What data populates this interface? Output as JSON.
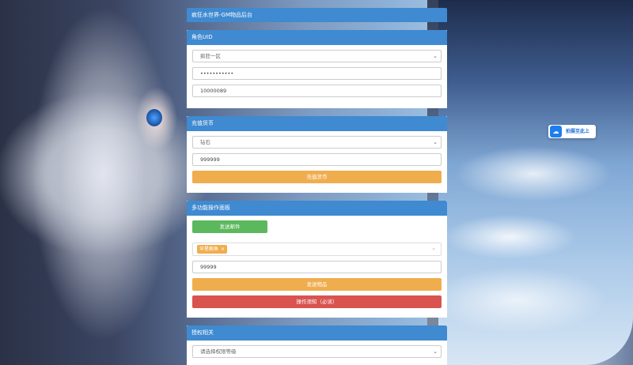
{
  "page_title": "疯狂水世界-GM物品后台",
  "role_card": {
    "header": "角色UID",
    "server_select": "疯狂一区",
    "password_value": "•••••••••••",
    "uid_value": "10000089"
  },
  "recharge_card": {
    "header": "充值货币",
    "currency_select": "钻石",
    "amount_value": "999999",
    "submit_label": "充值货币"
  },
  "multi_card": {
    "header": "多功能操作面板",
    "send_mail_label": "发送邮件",
    "selected_tag": "罕星鲸鱼",
    "tag_close": "×",
    "quantity_value": "99999",
    "send_item_label": "发送物品",
    "notice_label": "操作须知（必读）"
  },
  "auth_card": {
    "header": "授权相关",
    "level_placeholder": "请选择权限等级"
  },
  "float_button": {
    "label": "拍摄至此上",
    "icon": "cloud-icon"
  },
  "colors": {
    "header_blue": "#3f8ad0",
    "orange": "#f0ad4e",
    "red": "#d9534f",
    "green": "#5cb85c"
  }
}
